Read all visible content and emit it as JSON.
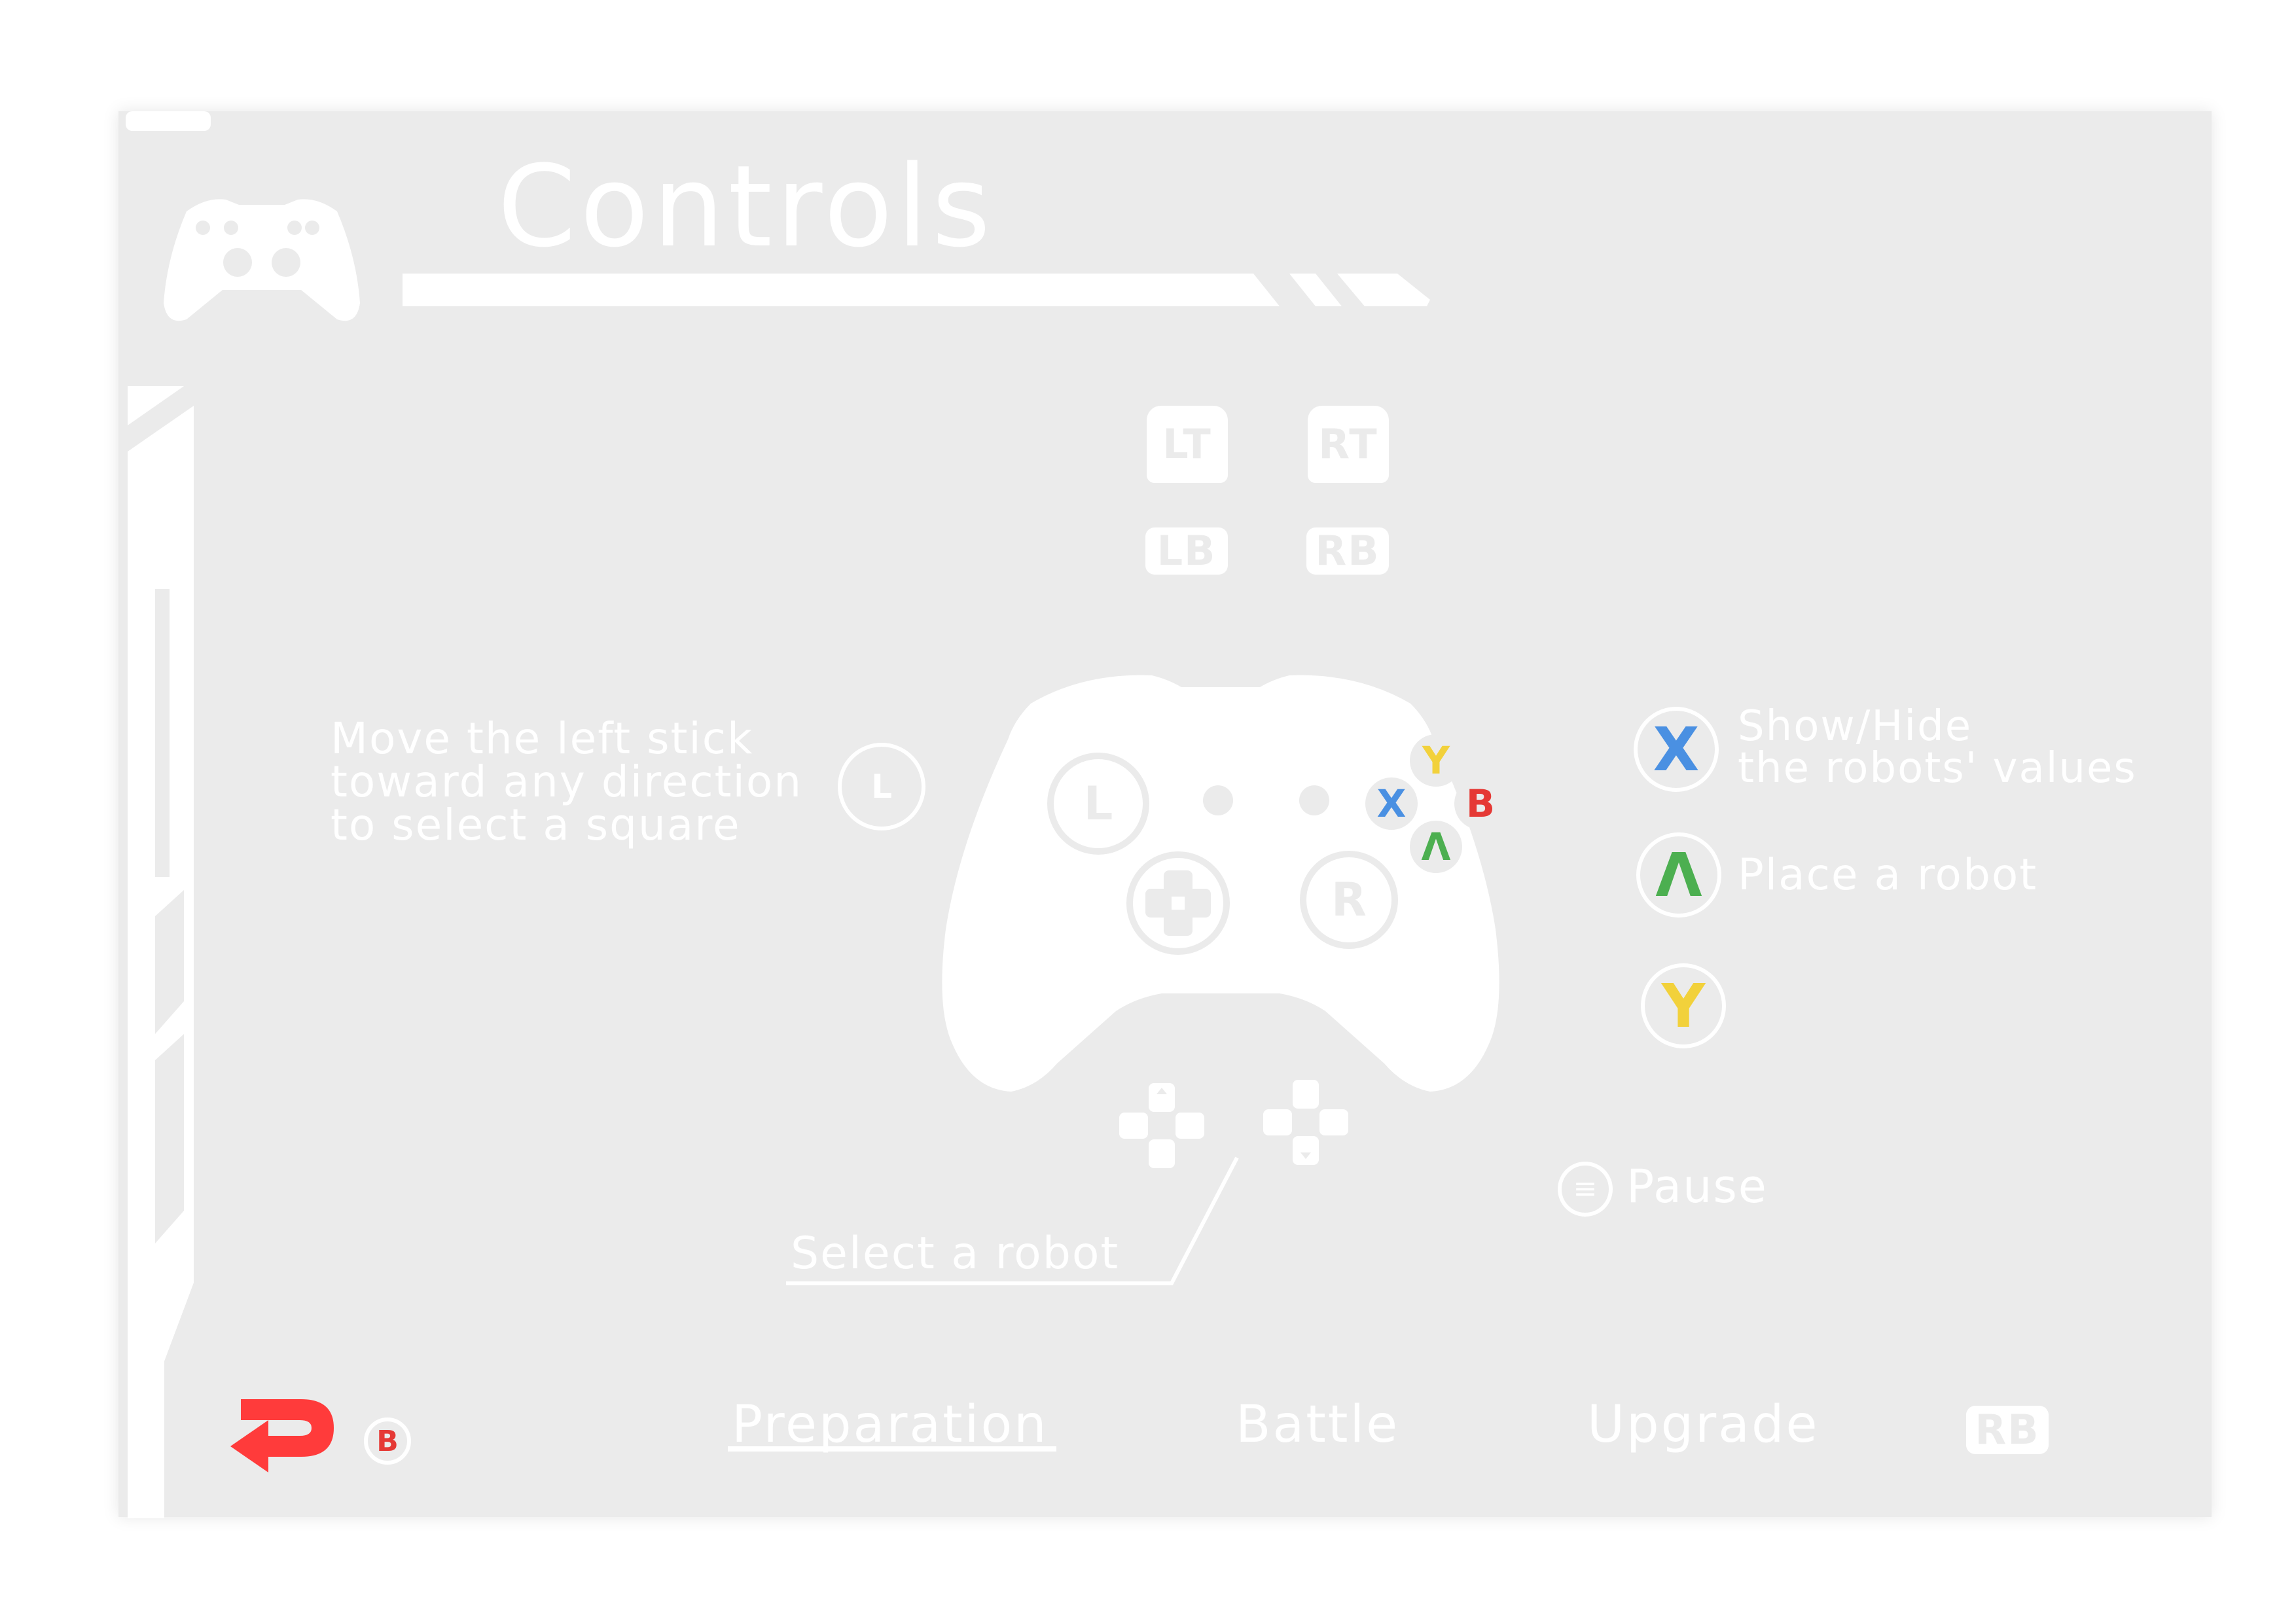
{
  "screen": {
    "title": "Controls",
    "colors": {
      "panel_bg": "#ebebeb",
      "foreground": "#ffffff",
      "x_blue": "#4a90e2",
      "b_red": "#e53935",
      "a_green": "#4caf50",
      "y_yellow": "#f2d13b",
      "back_red": "#ff3b3b"
    }
  },
  "shoulder_buttons": {
    "lt": "LT",
    "rt": "RT",
    "lb": "LB",
    "rb": "RB"
  },
  "controller": {
    "left_stick": "L",
    "right_stick": "R",
    "face": {
      "y": "Y",
      "x": "X",
      "b": "B",
      "a": "Λ"
    }
  },
  "left_stick_hint": {
    "line1": "Move the left stick",
    "line2": "toward any direction",
    "line3": "to select a square",
    "stick_label": "L"
  },
  "actions": {
    "x": {
      "button": "X",
      "line1": "Show/Hide",
      "line2": "the robots' values"
    },
    "a": {
      "button": "Λ",
      "label": "Place a robot"
    },
    "y": {
      "button": "Y",
      "label": ""
    },
    "pause": {
      "label": "Pause"
    },
    "dpad": {
      "label": "Select a robot"
    }
  },
  "footer": {
    "back_button_hint": "B",
    "tabs": [
      {
        "label": "Preparation",
        "active": true
      },
      {
        "label": "Battle",
        "active": false
      },
      {
        "label": "Upgrade",
        "active": false
      }
    ],
    "next_hint": "RB"
  }
}
